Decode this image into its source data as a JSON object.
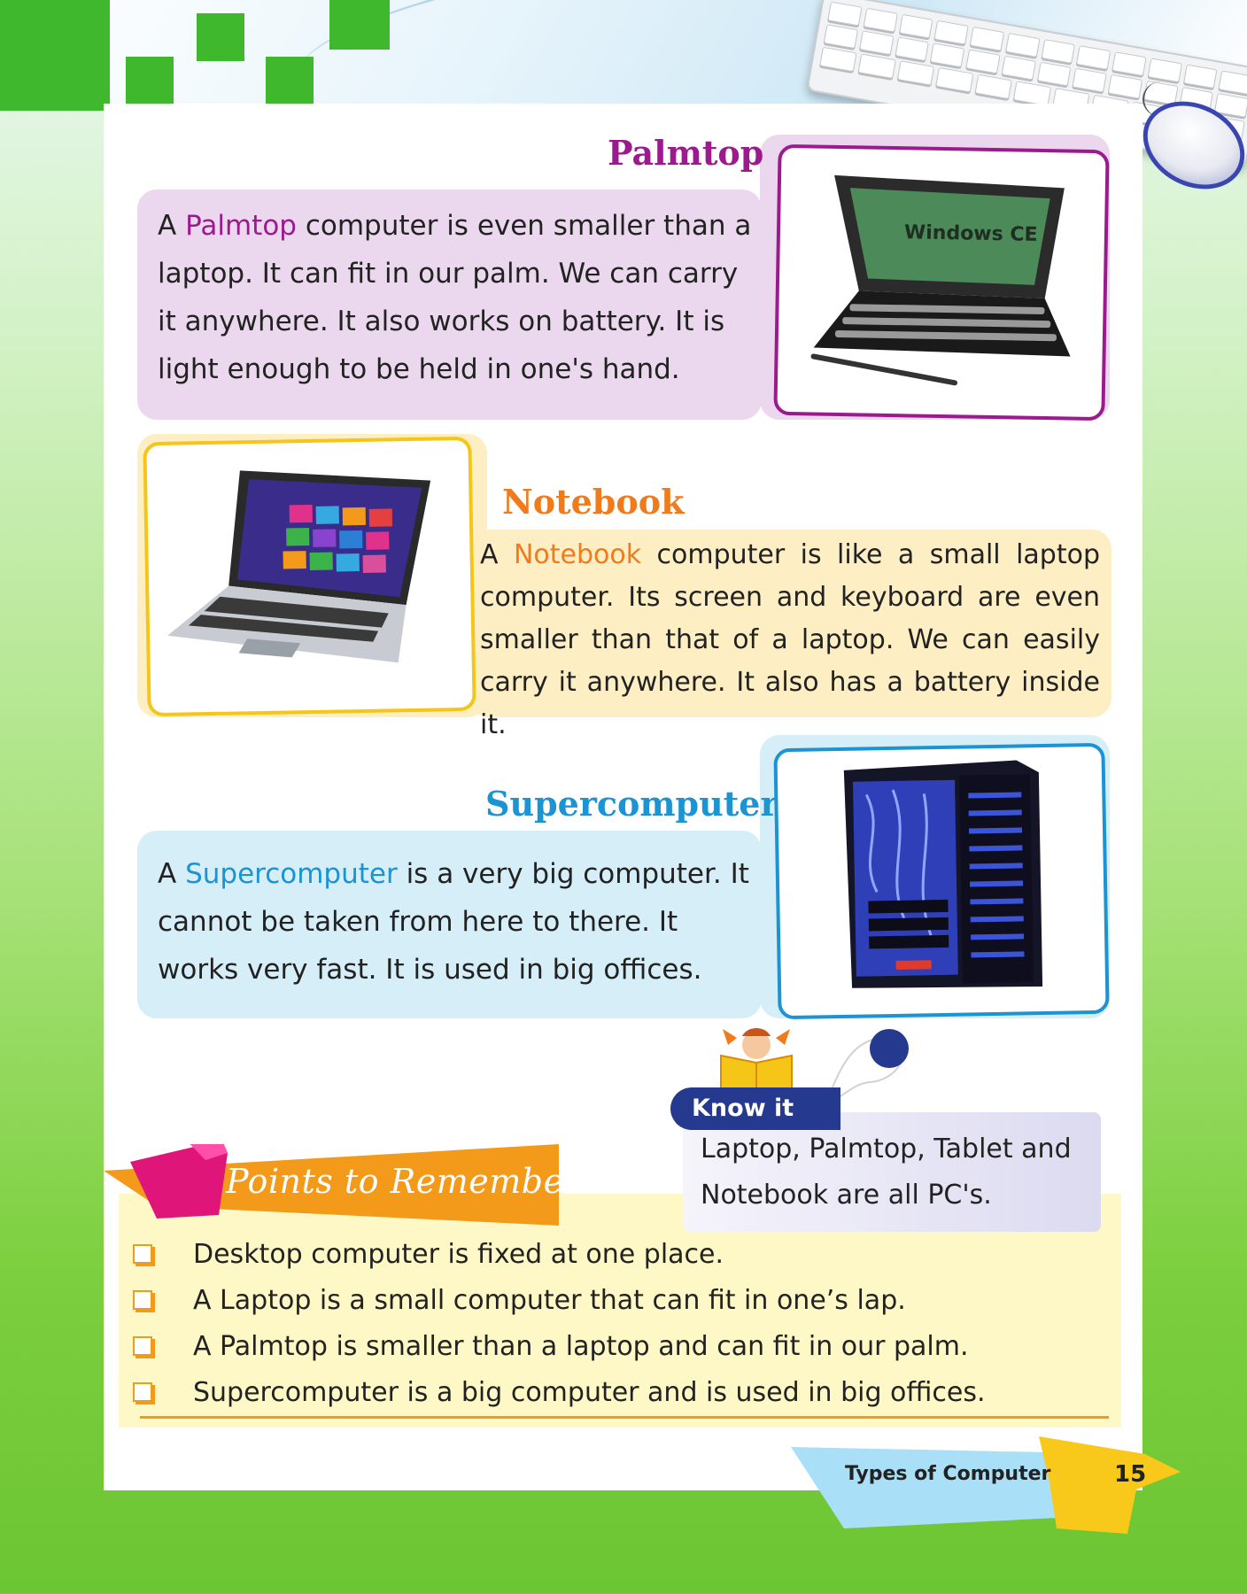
{
  "palmtop": {
    "heading": "Palmtop",
    "highlight": "Palmtop",
    "lead": "A ",
    "body": " computer is even smaller than a laptop. It can fit in our palm. We can carry it anywhere. It also works on battery. It is light enough to be held in one's hand.",
    "screen_text": "Windows CE"
  },
  "notebook": {
    "heading": "Notebook",
    "highlight": "Notebook",
    "lead": "A ",
    "body": " computer is like a small laptop computer. Its screen and keyboard are even smaller than that of a laptop. We can easily carry it anywhere. It also has a battery inside it."
  },
  "supercomputer": {
    "heading": "Supercomputer",
    "highlight": "Supercomputer",
    "lead": "A ",
    "body": " is a very big computer. It cannot be taken from here to there. It works very fast. It is used in big offices."
  },
  "know_it": {
    "tab": "Know it",
    "text": "Laptop, Palmtop, Tablet and Notebook are all PC's."
  },
  "points": {
    "title": "Points to Remember",
    "items": [
      "Desktop computer is fixed at one place.",
      "A Laptop is a small computer that can fit in one’s lap.",
      "A Palmtop is smaller than a laptop and can fit in our palm.",
      "Supercomputer is a big computer and is used in big offices."
    ]
  },
  "footer": {
    "chapter": "Types of Computer",
    "page_number": "15"
  },
  "colors": {
    "palmtop": "#9b1b8e",
    "notebook": "#f07b1c",
    "supercomputer": "#1c93d2",
    "accent_green": "#3fb82e"
  }
}
